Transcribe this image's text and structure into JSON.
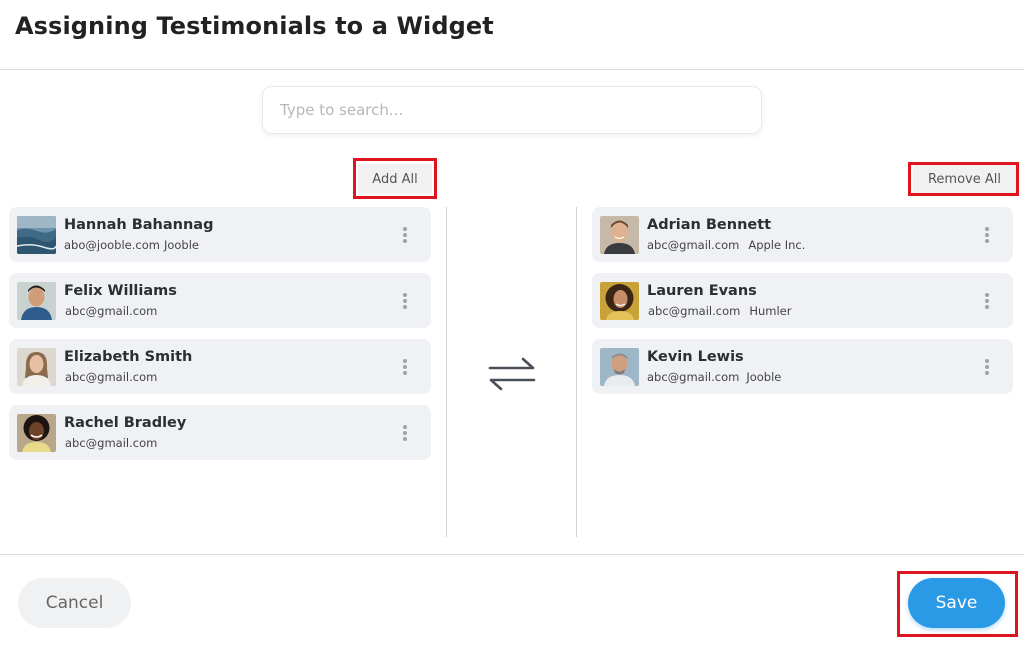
{
  "dialog": {
    "title": "Assigning Testimonials to a Widget"
  },
  "search": {
    "placeholder": "Type to search..."
  },
  "available": {
    "add_all_label": "Add All",
    "items": [
      {
        "name": "Hannah Bahannag",
        "email": "abo@jooble.com",
        "company": "Jooble",
        "avatar": "ocean-image"
      },
      {
        "name": "Felix Williams",
        "email": "abc@gmail.com",
        "company": "",
        "avatar": "person-photo"
      },
      {
        "name": "Elizabeth Smith",
        "email": "abc@gmail.com",
        "company": "",
        "avatar": "person-photo"
      },
      {
        "name": "Rachel Bradley",
        "email": "abc@gmail.com",
        "company": "",
        "avatar": "person-photo"
      }
    ]
  },
  "assigned": {
    "remove_all_label": "Remove All",
    "items": [
      {
        "name": "Adrian Bennett",
        "email": "abc@gmail.com",
        "company": "Apple Inc.",
        "avatar": "person-photo"
      },
      {
        "name": "Lauren Evans",
        "email": "abc@gmail.com",
        "company": "Humler",
        "avatar": "person-photo"
      },
      {
        "name": "Kevin Lewis",
        "email": "abc@gmail.com",
        "company": "Jooble",
        "avatar": "person-photo"
      }
    ]
  },
  "transfer": {
    "icon": "swap-arrows-icon"
  },
  "footer": {
    "cancel_label": "Cancel",
    "save_label": "Save"
  },
  "colors": {
    "accent": "#2b9ae6",
    "highlight": "#e0141e",
    "card_bg": "#eff1f4"
  }
}
